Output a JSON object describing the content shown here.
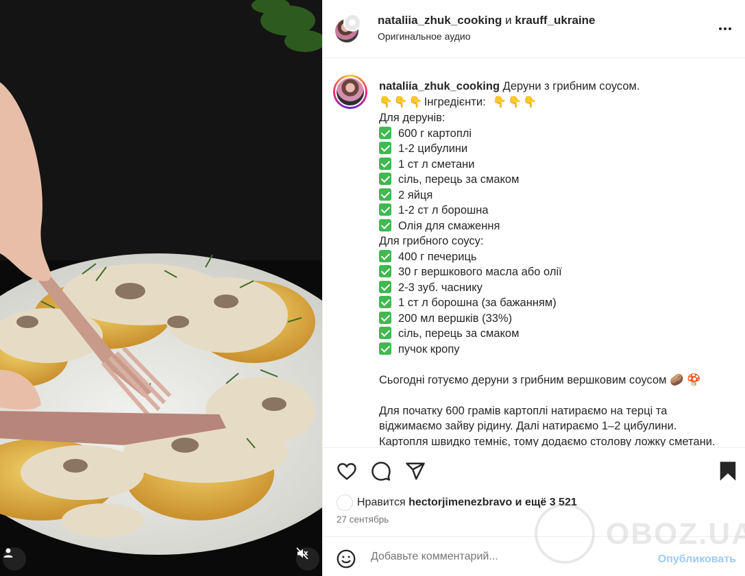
{
  "header": {
    "user1": "nataliia_zhuk_cooking",
    "joiner": "и",
    "user2": "krauff_ukraine",
    "audio": "Оригинальное аудио"
  },
  "caption": {
    "username": "nataliia_zhuk_cooking",
    "title": "Деруни з грибним соусом.",
    "ingredients_label": "Інгредієнти:",
    "section1": "Для дерунів:",
    "items1": [
      "600 г картоплі",
      "1-2 цибулини",
      "1 ст л сметани",
      "сіль, перець за смаком",
      "2 яйця",
      "1-2 ст л борошна",
      "Олія для смаження"
    ],
    "section2": "Для грибного соусу:",
    "items2": [
      "400 г печериць",
      "30 г вершкового масла або олії",
      "2-3 зуб. часнику",
      "1 ст л борошна (за бажанням)",
      "200 мл вершків (33%)",
      "сіль, перець за смаком",
      "пучок кропу"
    ],
    "para1": "Сьогодні готуємо деруни з грибним вершковим соусом 🥔 🍄",
    "para2_lines": [
      "Для початку 600 грамів картоплі натираємо на терці та",
      "віджимаємо зайву рідину. Далі натираємо 1–2 цибулини.",
      "Картопля швидко темніє, тому додаємо столову ложку сметани."
    ]
  },
  "likes": {
    "prefix": "Нравится",
    "user": "hectorjimenezbravo",
    "suffix": "и ещё 3 521"
  },
  "date": "27 сентябрь",
  "comment": {
    "placeholder": "Добавьте комментарий...",
    "publish": "Опубликовать"
  },
  "watermark": "OBOZ.UA",
  "icons": [
    "more-icon",
    "heart-icon",
    "comment-icon",
    "share-icon",
    "bookmark-icon",
    "emoji-icon",
    "user-icon",
    "mute-icon"
  ],
  "colors": {
    "check": "#3fb950",
    "publish": "#9fc9f5",
    "text": "#262626",
    "muted": "#737373"
  }
}
